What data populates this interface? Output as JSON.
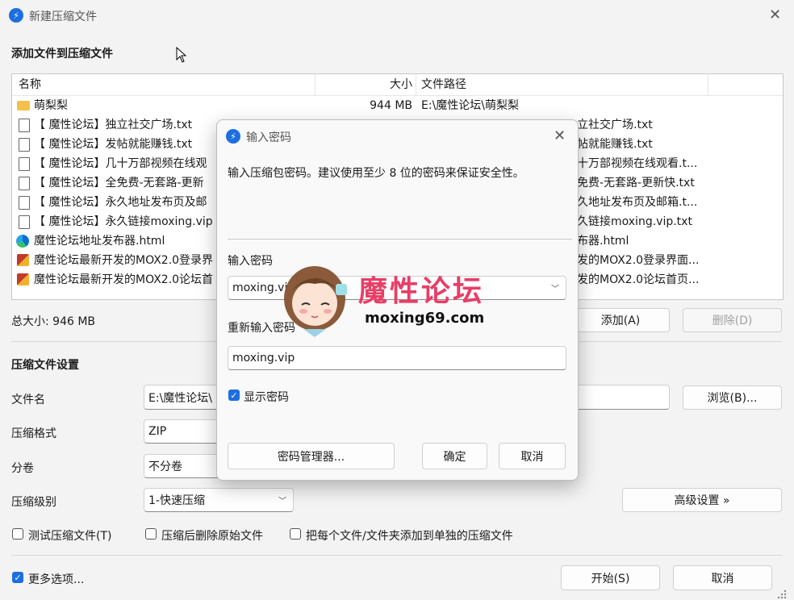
{
  "window": {
    "title": "新建压缩文件",
    "app_icon": "bandizip-icon",
    "close_glyph": "✕"
  },
  "add_section": {
    "title": "添加文件到压缩文件",
    "columns": {
      "name": "名称",
      "size": "大小",
      "path": "文件路径"
    },
    "rows": [
      {
        "icon": "folder-icon",
        "name": "萌梨梨",
        "size": "944 MB",
        "path": "E:\\魔性论坛\\萌梨梨"
      },
      {
        "icon": "text-file-icon",
        "name": "【 魔性论坛】独立社交广场.txt",
        "size": "",
        "path": "立社交广场.txt"
      },
      {
        "icon": "text-file-icon",
        "name": "【 魔性论坛】发帖就能赚钱.txt",
        "size": "",
        "path": "帖就能赚钱.txt"
      },
      {
        "icon": "text-file-icon",
        "name": "【 魔性论坛】几十万部视频在线观",
        "size": "",
        "path": "十万部视频在线观看.t..."
      },
      {
        "icon": "text-file-icon",
        "name": "【 魔性论坛】全免费-无套路-更新",
        "size": "",
        "path": "免费-无套路-更新快.txt"
      },
      {
        "icon": "text-file-icon",
        "name": "【 魔性论坛】永久地址发布页及邮",
        "size": "",
        "path": "久地址发布页及邮箱.t..."
      },
      {
        "icon": "text-file-icon",
        "name": "【 魔性论坛】永久链接moxing.vip",
        "size": "",
        "path": "久链接moxing.vip.txt"
      },
      {
        "icon": "edge-icon",
        "name": "魔性论坛地址发布器.html",
        "size": "",
        "path": "布器.html"
      },
      {
        "icon": "archive-icon",
        "name": "魔性论坛最新开发的MOX2.0登录界",
        "size": "",
        "path": "发的MOX2.0登录界面..."
      },
      {
        "icon": "archive-icon",
        "name": "魔性论坛最新开发的MOX2.0论坛首",
        "size": "",
        "path": "发的MOX2.0论坛首页..."
      }
    ],
    "total_size": "总大小: 946 MB",
    "add_button": "添加(A)",
    "delete_button": "删除(D)"
  },
  "settings": {
    "title": "压缩文件设置",
    "filename_label": "文件名",
    "filename_value": "E:\\魔性论坛\\",
    "browse_button": "浏览(B)...",
    "format_label": "压缩格式",
    "format_value": "ZIP",
    "split_label": "分卷",
    "split_value": "不分卷",
    "level_label": "压缩级别",
    "level_value": "1-快速压缩",
    "advanced_button": "高级设置 »",
    "test_checkbox": "测试压缩文件(T)",
    "delete_after_checkbox": "压缩后删除原始文件",
    "separate_checkbox": "把每个文件/文件夹添加到单独的压缩文件"
  },
  "footer": {
    "more_options": "更多选项...",
    "start_button": "开始(S)",
    "cancel_button": "取消"
  },
  "password_dialog": {
    "title": "输入密码",
    "description": "输入压缩包密码。建议使用至少 8 位的密码来保证安全性。",
    "password_label": "输入密码",
    "password_value": "moxing.vip",
    "reenter_label": "重新输入密码",
    "reenter_value": "moxing.vip",
    "show_password": "显示密码",
    "manager_button": "密码管理器...",
    "ok_button": "确定",
    "cancel_button": "取消"
  },
  "watermark": {
    "title": "魔性论坛",
    "url": "moxing69.com"
  },
  "colors": {
    "accent": "#1d6fe0",
    "watermark_pink": "#e83e66"
  }
}
